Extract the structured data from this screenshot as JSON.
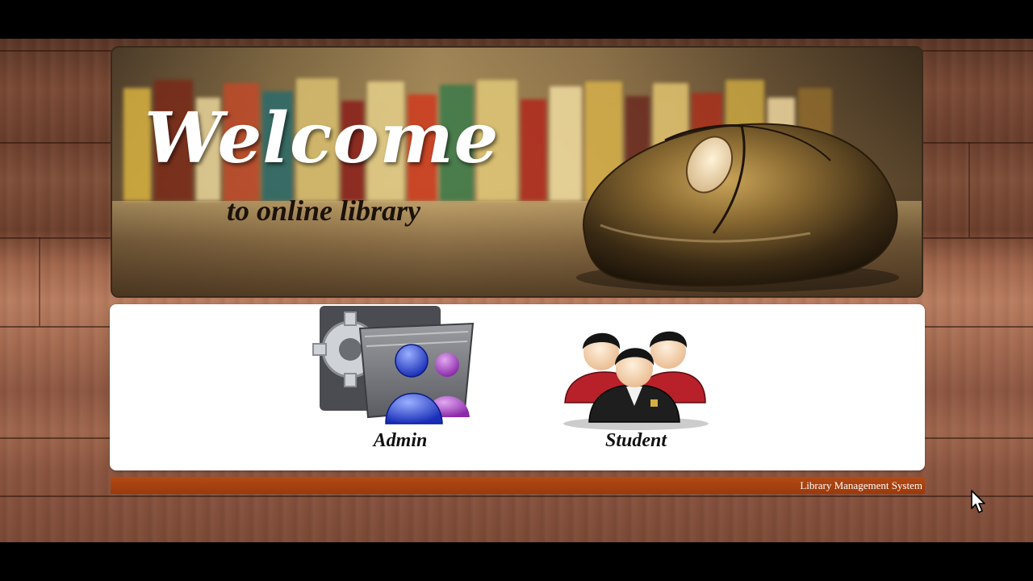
{
  "banner": {
    "title": "Welcome",
    "subtitle": "to online library",
    "graphic": "computer-mouse-image",
    "book_colors": [
      "#d8b240",
      "#7a2a18",
      "#e8d49a",
      "#c04a2a",
      "#2a6a6a",
      "#d9c070",
      "#8a1e1a",
      "#e6d08a",
      "#cf3a1e",
      "#3a7a4a",
      "#e0c878",
      "#b0281c",
      "#f0dca0",
      "#d6b04a",
      "#6a2a20",
      "#e2c470",
      "#a8301c",
      "#c9a642",
      "#efd7a0",
      "#8e6a2c"
    ]
  },
  "roles": [
    {
      "label": "Admin",
      "icon": "admin-settings-users-icon"
    },
    {
      "label": "Student",
      "icon": "student-group-icon"
    }
  ],
  "footer": {
    "text": "Library Management System"
  },
  "colors": {
    "footer_bar": "#a8410f",
    "panel": "#ffffff",
    "wood_dark": "#6a3e2c",
    "wood_light": "#b87c5f"
  }
}
